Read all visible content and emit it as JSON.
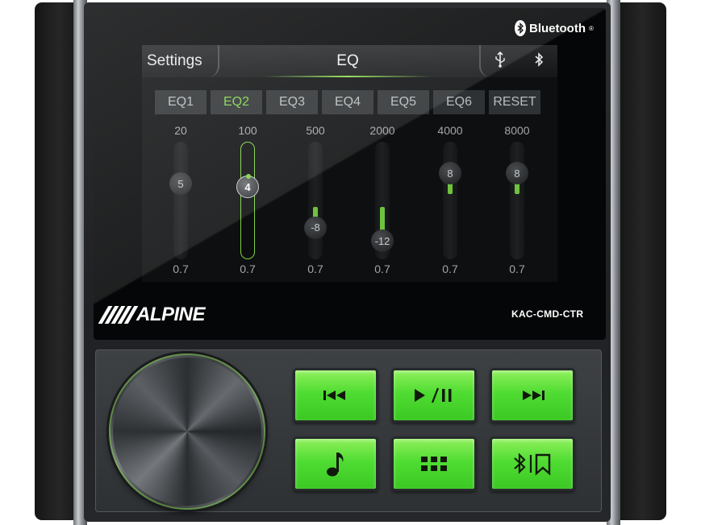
{
  "device": {
    "bluetooth_brand": "Bluetooth",
    "bluetooth_mark": "®",
    "brand": "ALPINE",
    "model": "KAC-CMD-CTR"
  },
  "screen": {
    "back_label": "Settings",
    "title": "EQ",
    "status_icons": [
      "usb-icon",
      "bluetooth-icon"
    ]
  },
  "presets": [
    {
      "label": "EQ1",
      "active": false
    },
    {
      "label": "EQ2",
      "active": true
    },
    {
      "label": "EQ3",
      "active": false
    },
    {
      "label": "EQ4",
      "active": false
    },
    {
      "label": "EQ5",
      "active": false
    },
    {
      "label": "EQ6",
      "active": false
    },
    {
      "label": "RESET",
      "active": false
    }
  ],
  "bands": [
    {
      "freq": "20",
      "gain": "5",
      "q": "0.7",
      "active": false
    },
    {
      "freq": "100",
      "gain": "4",
      "q": "0.7",
      "active": true
    },
    {
      "freq": "500",
      "gain": "-8",
      "q": "0.7",
      "active": false
    },
    {
      "freq": "2000",
      "gain": "-12",
      "q": "0.7",
      "active": false
    },
    {
      "freq": "4000",
      "gain": "8",
      "q": "0.7",
      "active": false
    },
    {
      "freq": "8000",
      "gain": "8",
      "q": "0.7",
      "active": false
    }
  ],
  "controls": {
    "buttons": [
      {
        "name": "previous-track-button",
        "icon": "skip-back-icon"
      },
      {
        "name": "play-pause-button",
        "icon": "play-pause-icon"
      },
      {
        "name": "next-track-button",
        "icon": "skip-forward-icon"
      },
      {
        "name": "audio-source-button",
        "icon": "music-note-icon"
      },
      {
        "name": "menu-button",
        "icon": "grid-icon"
      },
      {
        "name": "bluetooth-bookmark-button",
        "icon": "bluetooth-bookmark-icon"
      }
    ],
    "button_color": "#4fdc32",
    "accent_color": "#7ed348"
  }
}
